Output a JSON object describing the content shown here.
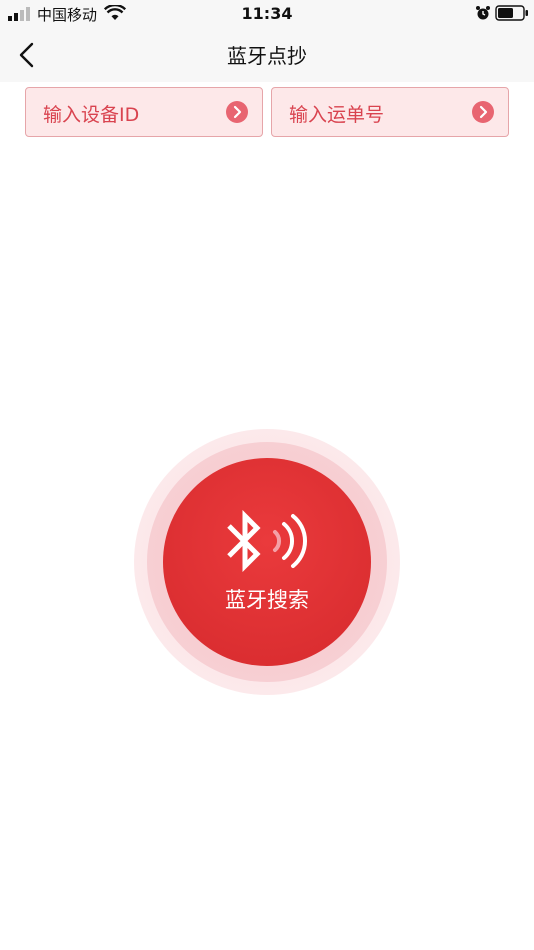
{
  "status_bar": {
    "carrier": "中国移动",
    "time": "11:34"
  },
  "header": {
    "title": "蓝牙点抄"
  },
  "actions": {
    "device_id_label": "输入设备ID",
    "waybill_label": "输入运单号"
  },
  "scan": {
    "label": "蓝牙搜索"
  },
  "colors": {
    "accent": "#d62a2d",
    "entry_bg": "#fde8e9",
    "entry_text": "#d9434f"
  }
}
